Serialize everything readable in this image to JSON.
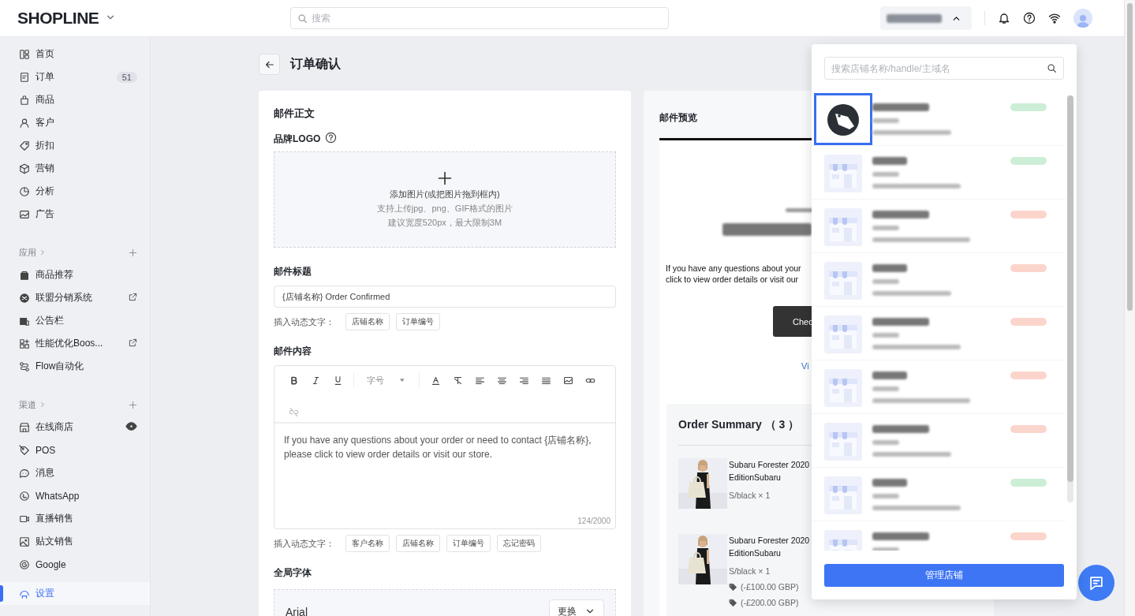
{
  "topbar": {
    "logo": "SHOPLINE",
    "search": {
      "placeholder": "搜索"
    },
    "store_selector": {
      "expanded": true
    }
  },
  "sidebar": {
    "items": [
      {
        "label": "首页",
        "selected": false
      },
      {
        "label": "订单",
        "badge": "51",
        "selected": false
      },
      {
        "label": "商品",
        "selected": false
      },
      {
        "label": "客户",
        "selected": false
      },
      {
        "label": "折扣",
        "selected": false
      },
      {
        "label": "营销",
        "selected": false
      },
      {
        "label": "分析",
        "selected": false
      },
      {
        "label": "广告",
        "selected": false
      }
    ],
    "sections": [
      {
        "title": "应用",
        "items": [
          {
            "label": "商品推荐",
            "external": false,
            "viewable": false,
            "selected": false
          },
          {
            "label": "联盟分销系统",
            "external": true,
            "viewable": false,
            "selected": false
          },
          {
            "label": "公告栏",
            "external": false,
            "viewable": false,
            "selected": false
          },
          {
            "label": "性能优化Boos...",
            "external": true,
            "viewable": false,
            "selected": false
          },
          {
            "label": "Flow自动化",
            "external": false,
            "viewable": false,
            "selected": false
          }
        ]
      },
      {
        "title": "渠道",
        "items": [
          {
            "label": "在线商店",
            "external": false,
            "viewable": true,
            "selected": false
          },
          {
            "label": "POS",
            "external": false,
            "viewable": false,
            "selected": false
          },
          {
            "label": "消息",
            "external": false,
            "viewable": false,
            "selected": false
          },
          {
            "label": "WhatsApp",
            "external": false,
            "viewable": false,
            "selected": false
          },
          {
            "label": "直播销售",
            "external": false,
            "viewable": false,
            "selected": false
          },
          {
            "label": "贴文销售",
            "external": false,
            "viewable": false,
            "selected": false
          },
          {
            "label": "Google",
            "external": false,
            "viewable": false,
            "selected": false
          }
        ]
      }
    ],
    "bottom_items": [
      {
        "label": "设置",
        "selected": true
      }
    ]
  },
  "page": {
    "title": "订单确认"
  },
  "editor_card": {
    "title": "邮件正文",
    "logo_label": "品牌LOGO",
    "upload": {
      "title": "添加图片(或把图片拖到框内)",
      "hints": [
        "支持上传jpg、png、GIF格式的图片",
        "建议宽度520px，最大限制3M"
      ]
    },
    "subject": {
      "label": "邮件标题",
      "value": "{店铺名称} Order Confirmed",
      "insert_label": "插入动态文字：",
      "tags": [
        "店铺名称",
        "订单编号"
      ]
    },
    "content": {
      "label": "邮件内容",
      "font_size_placeholder": "字号",
      "body": "If you have any questions about your order or need to contact {店铺名称}, please click to view order details or visit our store.",
      "counter": "124/2000",
      "insert_label": "插入动态文字：",
      "tags": [
        "客户名称",
        "店铺名称",
        "订单编号",
        "忘记密码"
      ]
    },
    "font": {
      "label": "全局字体",
      "value": "Arial",
      "button": "更换"
    }
  },
  "preview_card": {
    "title": "邮件预览",
    "body_lines": [
      "If you have any questions about your",
      "click to view order details or visit our"
    ],
    "button": "Chec",
    "link": "Vi",
    "summary": {
      "title": "Order Summary",
      "count": "（ 3 ）",
      "items": [
        {
          "name_lines": [
            "Subaru Forester 2020",
            "EditionSubaru"
          ],
          "variant": "S/black × 1"
        },
        {
          "name_lines": [
            "Subaru Forester 2020",
            "EditionSubaru"
          ],
          "variant": "S/black × 1",
          "discounts": [
            "(-£100.00 GBP)",
            "(-£200.00 GBP)"
          ]
        }
      ]
    }
  },
  "store_switcher": {
    "search_placeholder": "搜索店铺名称/handle/主域名",
    "stores": [
      {
        "kind": "logo",
        "selected": true,
        "color": "#cdeed6"
      },
      {
        "kind": "storefront",
        "selected": false,
        "color": "#cdeed6"
      },
      {
        "kind": "storefront",
        "selected": false,
        "color": "#fbd5cc"
      },
      {
        "kind": "storefront",
        "selected": false,
        "color": "#fbd5cc"
      },
      {
        "kind": "storefront",
        "selected": false,
        "color": "#fbd5cc"
      },
      {
        "kind": "storefront",
        "selected": false,
        "color": "#fbd5cc"
      },
      {
        "kind": "storefront",
        "selected": false,
        "color": "#fbd5cc"
      },
      {
        "kind": "storefront",
        "selected": false,
        "color": "#cdeed6"
      },
      {
        "kind": "storefront",
        "selected": false,
        "color": "#fbd5cc"
      }
    ],
    "manage_button": "管理店铺"
  }
}
